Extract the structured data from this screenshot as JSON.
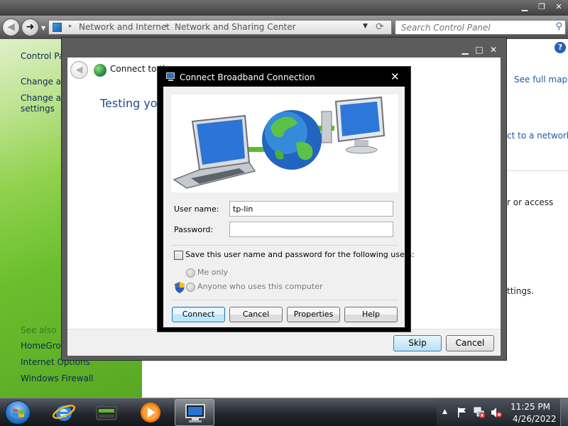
{
  "control_panel": {
    "breadcrumbs": [
      "Network and Internet",
      "Network and Sharing Center"
    ],
    "search_placeholder": "Search Control Panel",
    "sidebar": {
      "home": "Control Pa",
      "tasks": [
        "Change ad",
        "Change ad",
        "settings"
      ],
      "see_also_heading": "See also",
      "see_also": [
        "HomeGrou",
        "Internet Options",
        "Windows Firewall"
      ]
    },
    "right": {
      "see_full_map": "See full map",
      "connect_link": "ct to a network",
      "access_text": "r or access",
      "settings_text": "ttings."
    }
  },
  "wizard": {
    "title": "Connect to th",
    "heading": "Testing your",
    "skip_label": "Skip",
    "cancel_label": "Cancel"
  },
  "dialog": {
    "title": "Connect Broadband Connection",
    "close_glyph": "✕",
    "user_name_label": "User name:",
    "user_name_value": "tp-lin",
    "password_label": "Password:",
    "password_value": "",
    "save_label": "Save this user name and password for the following users:",
    "save_checked": false,
    "radio_me_only": "Me only",
    "radio_anyone": "Anyone who uses this computer",
    "buttons": {
      "connect": "Connect",
      "cancel": "Cancel",
      "properties": "Properties",
      "help": "Help"
    }
  },
  "taskbar": {
    "time": "11:25 PM",
    "date": "4/26/2022"
  },
  "colors": {
    "sidebar_green": "#6bbf2e",
    "link_blue": "#1e5aa8",
    "heading_blue": "#1f4b86",
    "dialog_frame": "#000000"
  },
  "icons": [
    "back-icon",
    "forward-icon",
    "control-panel-icon",
    "refresh-icon",
    "search-icon",
    "help-icon",
    "globe-icon",
    "laptop-icon",
    "monitor-icon",
    "shield-icon",
    "start-orb-icon",
    "ie-icon",
    "router-icon",
    "media-player-icon",
    "network-icon",
    "flag-icon",
    "network-tray-icon",
    "volume-muted-icon"
  ]
}
